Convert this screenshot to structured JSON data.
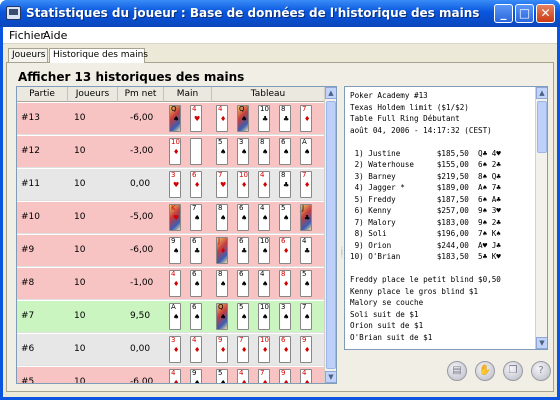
{
  "window": {
    "title": "Statistiques du joueur : Base de données de l'historique des mains",
    "minimize_label": "_",
    "maximize_label": "□",
    "close_label": "✕"
  },
  "menubar": {
    "items": [
      "Fichier",
      "Aide"
    ]
  },
  "tabs": [
    {
      "label": "Joueurs",
      "active": false
    },
    {
      "label": "Historique des mains",
      "active": true
    }
  ],
  "heading": "Afficher 13 historiques des mains",
  "table": {
    "columns": [
      "Partie",
      "Joueurs",
      "Pm net",
      "Main",
      "Tableau"
    ],
    "rows": [
      {
        "partie": "#13",
        "joueurs": "10",
        "pm_net": "-6,00",
        "status": "red",
        "main": [
          [
            "Q",
            "♠"
          ],
          [
            "4",
            "♥"
          ]
        ],
        "tableau": [
          [
            "4",
            "♦"
          ],
          [
            "Q",
            "♠"
          ],
          [
            "10",
            "♣"
          ],
          [
            "8",
            "♣"
          ],
          [
            "7",
            "♦"
          ]
        ]
      },
      {
        "partie": "#12",
        "joueurs": "10",
        "pm_net": "-3,00",
        "status": "red",
        "main": [
          [
            "10",
            "♦"
          ],
          [
            "",
            ""
          ]
        ],
        "tableau": [
          [
            "5",
            "♠"
          ],
          [
            "3",
            "♠"
          ],
          [
            "8",
            "♠"
          ],
          [
            "6",
            "♠"
          ],
          [
            "A",
            "♠"
          ]
        ]
      },
      {
        "partie": "#11",
        "joueurs": "10",
        "pm_net": "0,00",
        "status": "gray",
        "main": [
          [
            "3",
            "♥"
          ],
          [
            "6",
            "♦"
          ]
        ],
        "tableau": [
          [
            "7",
            "♥"
          ],
          [
            "10",
            "♦"
          ],
          [
            "4",
            "♦"
          ],
          [
            "8",
            "♣"
          ],
          [
            "7",
            "♦"
          ]
        ]
      },
      {
        "partie": "#10",
        "joueurs": "10",
        "pm_net": "-5,00",
        "status": "red",
        "main": [
          [
            "K",
            "♥"
          ],
          [
            "7",
            "♠"
          ]
        ],
        "tableau": [
          [
            "8",
            "♠"
          ],
          [
            "6",
            "♠"
          ],
          [
            "4",
            "♠"
          ],
          [
            "5",
            "♠"
          ],
          [
            "J",
            "♣"
          ]
        ]
      },
      {
        "partie": "#9",
        "joueurs": "10",
        "pm_net": "-6,00",
        "status": "red",
        "main": [
          [
            "9",
            "♠"
          ],
          [
            "6",
            "♣"
          ]
        ],
        "tableau": [
          [
            "J",
            "♦"
          ],
          [
            "6",
            "♣"
          ],
          [
            "10",
            "♠"
          ],
          [
            "6",
            "♦"
          ],
          [
            "4",
            "♣"
          ]
        ]
      },
      {
        "partie": "#8",
        "joueurs": "10",
        "pm_net": "-1,00",
        "status": "red",
        "main": [
          [
            "4",
            "♦"
          ],
          [
            "6",
            "♠"
          ]
        ],
        "tableau": [
          [
            "8",
            "♠"
          ],
          [
            "6",
            "♠"
          ],
          [
            "4",
            "♠"
          ],
          [
            "8",
            "♦"
          ],
          [
            "5",
            "♠"
          ]
        ]
      },
      {
        "partie": "#7",
        "joueurs": "10",
        "pm_net": "9,50",
        "status": "green",
        "main": [
          [
            "A",
            "♠"
          ],
          [
            "6",
            "♠"
          ]
        ],
        "tableau": [
          [
            "Q",
            "♠"
          ],
          [
            "5",
            "♠"
          ],
          [
            "10",
            "♠"
          ],
          [
            "3",
            "♠"
          ],
          [
            "7",
            "♠"
          ]
        ]
      },
      {
        "partie": "#6",
        "joueurs": "10",
        "pm_net": "0,00",
        "status": "gray",
        "main": [
          [
            "3",
            "♦"
          ],
          [
            "4",
            "♦"
          ]
        ],
        "tableau": [
          [
            "9",
            "♦"
          ],
          [
            "7",
            "♦"
          ],
          [
            "10",
            "♦"
          ],
          [
            "6",
            "♦"
          ],
          [
            "9",
            "♦"
          ]
        ]
      },
      {
        "partie": "#5",
        "joueurs": "10",
        "pm_net": "-6,00",
        "status": "red",
        "main": [
          [
            "4",
            "♦"
          ],
          [
            "9",
            "♠"
          ]
        ],
        "tableau": [
          [
            "5",
            "♠"
          ],
          [
            "4",
            "♦"
          ],
          [
            "7",
            "♦"
          ],
          [
            "9",
            "♦"
          ],
          [
            "4",
            "♦"
          ]
        ]
      }
    ]
  },
  "history_text": [
    "Poker Academy #13",
    "Texas Holdem limit ($1/$2)",
    "Table Full Ring Débutant",
    "août 04, 2006 - 14:17:32 (CEST)",
    "",
    " 1) Justine        $185,50  Q♣ 4♥",
    " 2) Waterhouse     $155,00  6♠ 2♣",
    " 3) Barney         $219,50  8♠ Q♣",
    " 4) Jagger *       $189,00  A♠ 7♣",
    " 5) Freddy         $187,50  6♠ A♣",
    " 6) Kenny          $257,00  9♠ 3♥",
    " 7) Malory         $183,00  9♠ 2♣",
    " 8) Soli           $196,00  7♠ K♠",
    " 9) Orion          $244,00  A♥ J♣",
    "10) O'Brian        $183,50  5♣ K♥",
    "",
    "Freddy place le petit blind $0,50",
    "Kenny place le gros blind $1",
    "Malory se couche",
    "Soli suit de $1",
    "Orion suit de $1",
    "O'Brian suit de $1"
  ],
  "actions": [
    {
      "name": "database-icon",
      "glyph": "▤"
    },
    {
      "name": "hand-icon",
      "glyph": "✋"
    },
    {
      "name": "copy-icon",
      "glyph": "❐"
    },
    {
      "name": "help-icon",
      "glyph": "?"
    }
  ],
  "colors": {
    "title_bar": "#0a54e0",
    "row_loss": "#f7c3c3",
    "row_even": "#e7e7e7",
    "row_win": "#caf5c1"
  }
}
